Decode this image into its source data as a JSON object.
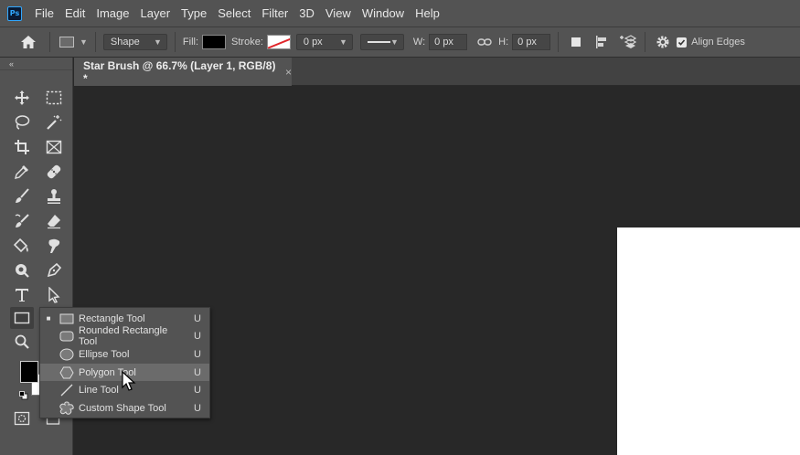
{
  "app": {
    "logo_text": "Ps"
  },
  "menu": [
    "File",
    "Edit",
    "Image",
    "Layer",
    "Type",
    "Select",
    "Filter",
    "3D",
    "View",
    "Window",
    "Help"
  ],
  "options_bar": {
    "mode": "Shape",
    "fill_label": "Fill:",
    "stroke_label": "Stroke:",
    "stroke_width": "0 px",
    "w_label": "W:",
    "w_value": "0 px",
    "h_label": "H:",
    "h_value": "0 px",
    "align_edges_label": "Align Edges",
    "align_edges_checked": true,
    "fill_color": "#000000",
    "stroke_color": "#ffffff"
  },
  "toolbar": {
    "collapse_glyph": "«",
    "fg_color": "#000000",
    "bg_color": "#ffffff"
  },
  "document": {
    "tab_title": "Star Brush @ 66.7% (Layer 1, RGB/8) *",
    "close_glyph": "×"
  },
  "flyout": {
    "items": [
      {
        "label": "Rectangle Tool",
        "shortcut": "U",
        "icon": "rectangle-icon",
        "selected": true
      },
      {
        "label": "Rounded Rectangle Tool",
        "shortcut": "U",
        "icon": "rounded-rectangle-icon",
        "selected": false
      },
      {
        "label": "Ellipse Tool",
        "shortcut": "U",
        "icon": "ellipse-icon",
        "selected": false
      },
      {
        "label": "Polygon Tool",
        "shortcut": "U",
        "icon": "polygon-icon",
        "selected": false,
        "hover": true
      },
      {
        "label": "Line Tool",
        "shortcut": "U",
        "icon": "line-icon",
        "selected": false
      },
      {
        "label": "Custom Shape Tool",
        "shortcut": "U",
        "icon": "custom-shape-icon",
        "selected": false
      }
    ],
    "selected_marker": "■"
  },
  "colors": {
    "ui_panel": "#535353",
    "workspace": "#282828",
    "accent": "#31a8ff"
  }
}
